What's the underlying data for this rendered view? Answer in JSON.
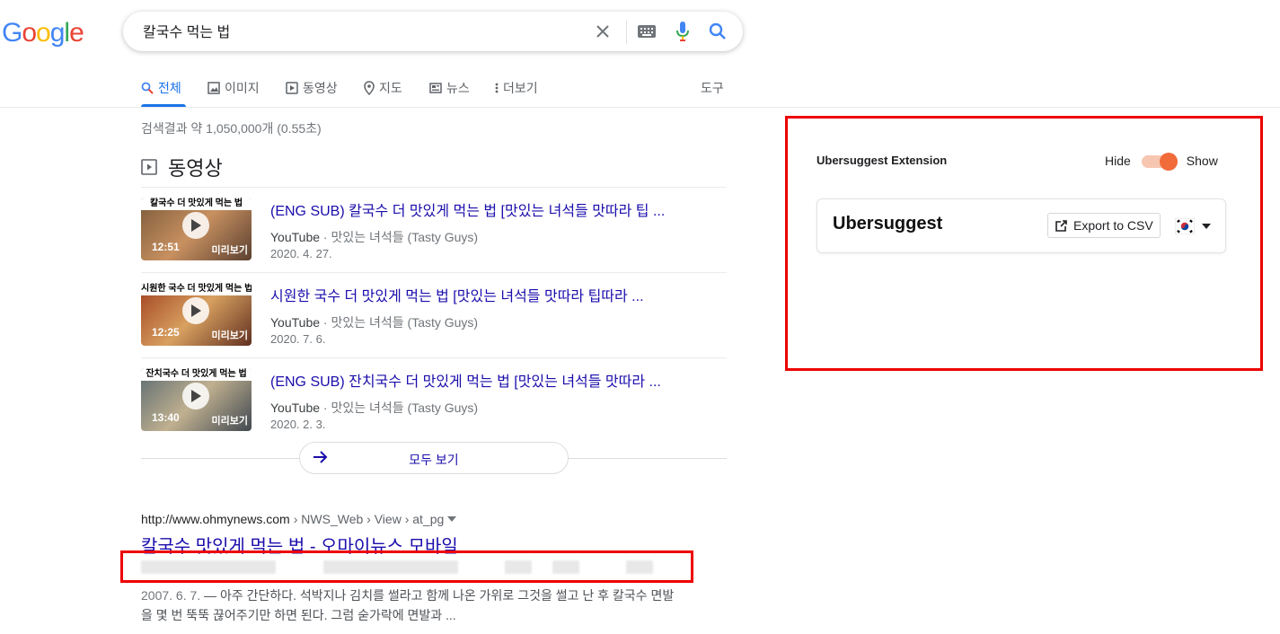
{
  "logo": [
    "G",
    "o",
    "o",
    "g",
    "l",
    "e"
  ],
  "logo_colors": [
    "#4285F4",
    "#EA4335",
    "#FBBC05",
    "#4285F4",
    "#34A853",
    "#EA4335"
  ],
  "search": {
    "query": "칼국수 먹는 법"
  },
  "tabs": [
    {
      "label": "전체",
      "icon": "search-icon",
      "active": true
    },
    {
      "label": "이미지",
      "icon": "image-icon"
    },
    {
      "label": "동영상",
      "icon": "video-icon"
    },
    {
      "label": "지도",
      "icon": "map-pin-icon"
    },
    {
      "label": "뉴스",
      "icon": "news-icon"
    },
    {
      "label": "더보기",
      "icon": "more-vert-icon"
    }
  ],
  "tools_label": "도구",
  "stats": "검색결과 약 1,050,000개 (0.55초)",
  "videos": {
    "heading": "동영상",
    "items": [
      {
        "title": "(ENG SUB) 칼국수 더 맛있게 먹는 법 [맛있는 녀석들 맛따라 팁 ...",
        "source": "YouTube",
        "channel": "맛있는 녀석들 (Tasty Guys)",
        "date": "2020. 4. 27.",
        "duration": "12:51",
        "thumb_text": "칼국수 더 맛있게 먹는 법",
        "thumb_tag": "미리보기"
      },
      {
        "title": "시원한 국수 더 맛있게 먹는 법 [맛있는 녀석들 맛따라 팁따라 ...",
        "source": "YouTube",
        "channel": "맛있는 녀석들 (Tasty Guys)",
        "date": "2020. 7. 6.",
        "duration": "12:25",
        "thumb_text": "시원한 국수 더 맛있게 먹는 법",
        "thumb_tag": "미리보기"
      },
      {
        "title": "(ENG SUB) 잔치국수 더 맛있게 먹는 법 [맛있는 녀석들 맛따라 ...",
        "source": "YouTube",
        "channel": "맛있는 녀석들 (Tasty Guys)",
        "date": "2020. 2. 3.",
        "duration": "13:40",
        "thumb_text": "잔치국수 더 맛있게 먹는 법",
        "thumb_tag": "미리보기"
      }
    ],
    "see_all": "모두 보기"
  },
  "result": {
    "domain": "http://www.ohmynews.com",
    "breadcrumb": "› NWS_Web › View › at_pg",
    "title": "칼국수 맛있게 먹는 법 - 오마이뉴스 모바일",
    "date": "2007. 6. 7.",
    "snippet": " — 아주 간단하다. 석박지나 김치를 썰라고 함께 나온 가위로 그것을 썰고 난 후 칼국수 면발을 몇 번 뚝뚝 끊어주기만 하면 된다. 그럼 숟가락에 면발과 ..."
  },
  "ubersuggest": {
    "extension_title": "Ubersuggest Extension",
    "hide_label": "Hide",
    "show_label": "Show",
    "toggle_state": "show",
    "brand": "Ubersuggest",
    "export_label": "Export to CSV",
    "country_flag": "kr-flag-icon"
  },
  "colors": {
    "link": "#1a0dab",
    "accent": "#1a73e8",
    "toggle": "#f26b3a",
    "highlight_box": "#e00000"
  }
}
